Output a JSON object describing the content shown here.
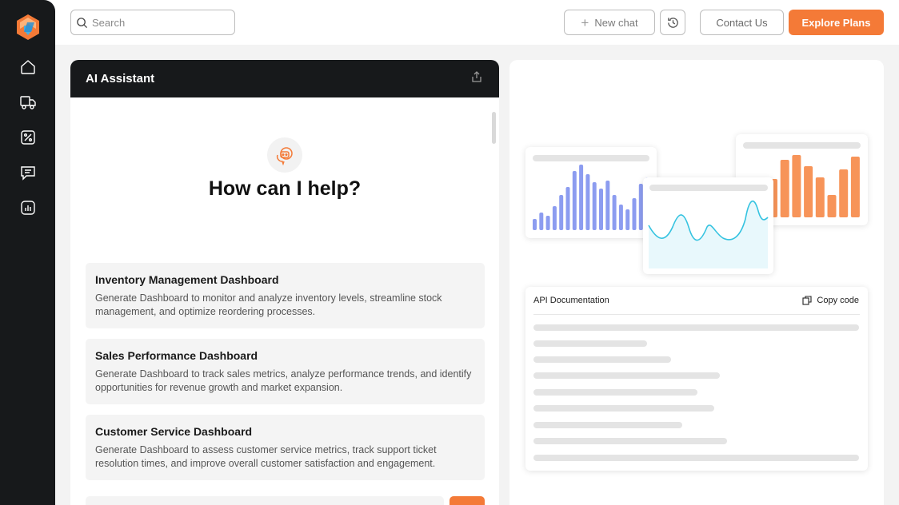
{
  "search": {
    "placeholder": "Search"
  },
  "toolbar": {
    "new_chat_label": "New chat",
    "contact_label": "Contact Us",
    "explore_label": "Explore Plans"
  },
  "colors": {
    "accent": "#f47a37",
    "dark": "#17191b",
    "bar_blue": "#8c9cf0",
    "bar_orange": "#f79459",
    "line_cyan": "#35c3e0"
  },
  "sidebar": {
    "items": [
      {
        "icon": "home-icon"
      },
      {
        "icon": "truck-icon"
      },
      {
        "icon": "discount-icon"
      },
      {
        "icon": "message-icon"
      },
      {
        "icon": "analytics-icon"
      }
    ]
  },
  "assistant": {
    "title": "AI Assistant",
    "heading": "How can I help?",
    "suggestions": [
      {
        "title": "Inventory Management Dashboard",
        "description": "Generate Dashboard to monitor and analyze inventory levels, streamline stock management, and optimize reordering processes."
      },
      {
        "title": "Sales Performance Dashboard",
        "description": "Generate Dashboard to track sales metrics, analyze performance trends, and identify opportunities for revenue growth and market expansion."
      },
      {
        "title": "Customer Service Dashboard",
        "description": "Generate Dashboard to assess customer service metrics, track support ticket resolution times, and improve overall customer satisfaction and engagement."
      }
    ]
  },
  "preview": {
    "api_title": "API Documentation",
    "copy_label": "Copy code"
  }
}
